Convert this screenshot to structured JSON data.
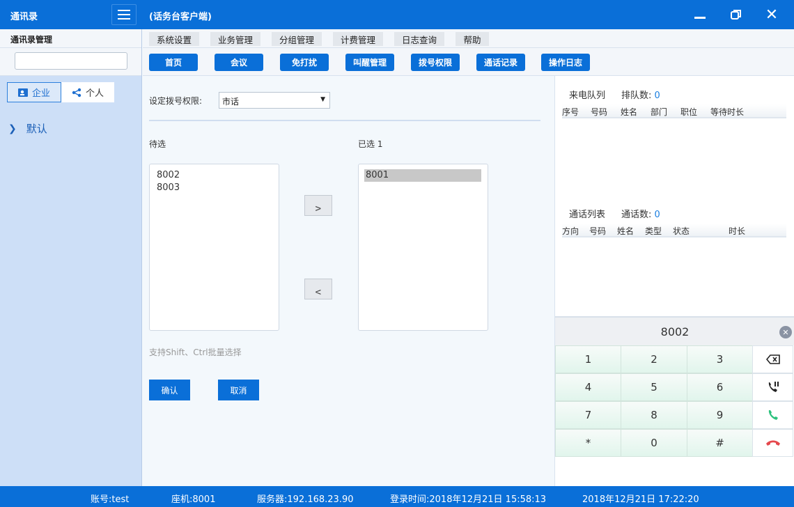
{
  "titlebar": {
    "app_title": "通讯录",
    "client_title": "(话务台客户端)"
  },
  "left": {
    "header": "通讯录管理",
    "search_value": "",
    "tabs": [
      {
        "label": "企业",
        "icon": "contact-card-icon"
      },
      {
        "label": "个人",
        "icon": "share-icon"
      }
    ],
    "tree": [
      {
        "label": "默认"
      }
    ]
  },
  "menu": [
    {
      "label": "系统设置"
    },
    {
      "label": "业务管理"
    },
    {
      "label": "分组管理"
    },
    {
      "label": "计费管理"
    },
    {
      "label": "日志查询"
    },
    {
      "label": "帮助"
    }
  ],
  "toolbar": [
    {
      "label": "首页"
    },
    {
      "label": "会议"
    },
    {
      "label": "免打扰"
    },
    {
      "label": "叫醒管理"
    },
    {
      "label": "拨号权限"
    },
    {
      "label": "通话记录"
    },
    {
      "label": "操作日志"
    }
  ],
  "permission": {
    "label": "设定拨号权限:",
    "selected": "市话",
    "available_label": "待选",
    "selected_label": "已选 1",
    "available": [
      "8002",
      "8003"
    ],
    "chosen": [
      "8001"
    ],
    "hint": "支持Shift、Ctrl批量选择",
    "confirm": "确认",
    "cancel": "取消"
  },
  "queue": {
    "title": "来电队列",
    "count_label": "排队数:",
    "count": "0",
    "columns": [
      "序号",
      "号码",
      "姓名",
      "部门",
      "职位",
      "等待时长"
    ]
  },
  "calls": {
    "title": "通话列表",
    "count_label": "通话数:",
    "count": "0",
    "columns": [
      "方向",
      "号码",
      "姓名",
      "类型",
      "状态",
      "时长"
    ]
  },
  "dialer": {
    "display": "8002",
    "keys": [
      "1",
      "2",
      "3",
      "4",
      "5",
      "6",
      "7",
      "8",
      "9",
      "*",
      "0",
      "#"
    ],
    "side_icons": [
      "backspace-icon",
      "hold-call-icon",
      "answer-call-icon",
      "hangup-icon"
    ]
  },
  "status": {
    "account": "账号:test",
    "seat": "座机:8001",
    "server": "服务器:192.168.23.90",
    "login": "登录时间:2018年12月21日 15:58:13",
    "now": "2018年12月21日 17:22:20"
  },
  "colors": {
    "primary": "#0a6fd8",
    "sidebar": "#cddff7",
    "answer": "#2ec27e",
    "hangup": "#e5484d"
  }
}
